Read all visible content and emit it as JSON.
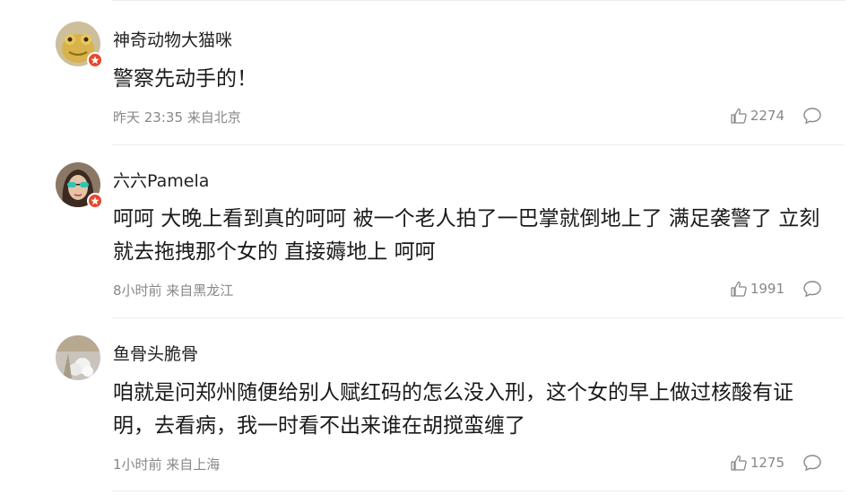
{
  "comments": [
    {
      "username": "神奇动物大猫咪",
      "text": "警察先动手的！",
      "meta": "昨天 23:35 来自北京",
      "likes": "2274",
      "avatar": "gold-frog-avatar",
      "verified": true
    },
    {
      "username": "六六Pamela",
      "text": "呵呵 大晚上看到真的呵呵 被一个老人拍了一巴掌就倒地上了 满足袭警了 立刻就去拖拽那个女的 直接薅地上 呵呵",
      "meta": "8小时前 来自黑龙江",
      "likes": "1991",
      "avatar": "woman-sunglasses-avatar",
      "verified": true
    },
    {
      "username": "鱼骨头脆骨",
      "text": "咱就是问郑州随便给别人赋红码的怎么没入刑，这个女的早上做过核酸有证明，去看病，我一时看不出来谁在胡搅蛮缠了",
      "meta": "1小时前 来自上海",
      "likes": "1275",
      "avatar": "flowers-avatar",
      "verified": false
    }
  ],
  "icons": {
    "like": "thumbs-up-icon",
    "reply": "comment-bubble-icon",
    "verified": "verified-badge-icon"
  },
  "colors": {
    "badge": "#e8452c",
    "meta_text": "#888888",
    "body_text": "#1a1a1a"
  }
}
